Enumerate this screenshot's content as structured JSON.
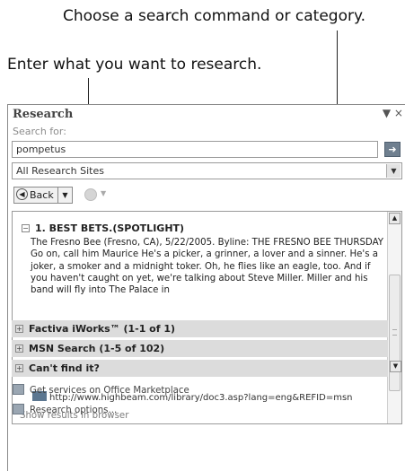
{
  "callouts": {
    "top": "Choose a search command or category.",
    "left": "Enter what you want to research."
  },
  "pane": {
    "title": "Research",
    "title_buttons": "▼ ×",
    "search_label": "Search for:",
    "search_value": "pompetus",
    "go_icon": "➜",
    "source_value": "All Research Sites",
    "back_label": "Back"
  },
  "result": {
    "title": "1. BEST BETS.(SPOTLIGHT)",
    "body": "The Fresno Bee (Fresno, CA), 5/22/2005. Byline: THE FRESNO BEE THURSDAY Go on, call him Maurice He's a picker, a grinner, a lover and a sinner. He's a joker, a smoker and a midnight toker. Oh, he flies like an eagle, too. And if you haven't caught on yet, we're talking about Steve Miller. Miller and his band will fly into The Palace in",
    "url": "http://www.highbeam.com/library/doc3.asp?lang=eng&REFID=msn",
    "show_results": "Show results in browser"
  },
  "groups": [
    "Factiva iWorks™ (1-1 of 1)",
    "MSN Search (1-5 of 102)",
    "Can't find it?"
  ],
  "bottom_links": [
    "Get services on Office Marketplace",
    "Research options..."
  ]
}
